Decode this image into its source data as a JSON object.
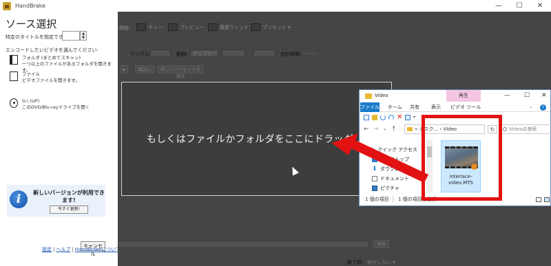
{
  "window": {
    "title": "HandBrake",
    "min_label": "—",
    "max_label": "☐",
    "close_label": "✕"
  },
  "source_panel": {
    "title": "ソース選択",
    "title_spec_label": "特定のタイトルを指定できます:",
    "spinner_up": "▲",
    "spinner_down": "▼",
    "prompt": "エンコードしたいビデオを選んでください:",
    "folder_option": {
      "title": "フォルダ (まとめてスキャン)",
      "desc": "一つ以上のファイルがあるフォルダを開きます。"
    },
    "file_option": {
      "title": "ファイル",
      "desc": "ビデオファイルを開きます。"
    },
    "disc_option": {
      "title": "G:\\ (UP)",
      "desc": "このDVD/Blu-rayドライブを開く"
    },
    "update_notice": "新しいバージョンが利用できます!",
    "update_button": "今すぐ更新!",
    "info_glyph": "i",
    "cancel_button": "キャンセル",
    "links": [
      "設定",
      "ヘルプ",
      "HandBrakeについて"
    ],
    "link_sep": "|"
  },
  "main_dimmed": {
    "toolbar": [
      "開始",
      "キュー",
      "プレビュー",
      "履歴ウィンドウ",
      "プリセット ▾"
    ],
    "angle_label": "アングル:",
    "range_label": "範囲:",
    "range_value": "チャプター",
    "duration_label": "合計時間:",
    "duration_value": "--:--:--",
    "dash": "-",
    "play_glyph": "▶",
    "reload_button": "再読込",
    "save_preset_button": "新しいプリセットを保存",
    "drop_text": "もしくはファイルかフォルダをここにドラッグ ...",
    "browse_button": "参照",
    "when_done_label": "終了時:",
    "when_done_value": "何もしない ▾"
  },
  "explorer": {
    "title": "Video",
    "context_tab": "再生",
    "tabs": [
      "ファイル",
      "ホーム",
      "共有",
      "表示",
      "ビデオ ツール"
    ],
    "min_label": "—",
    "max_label": "☐",
    "close_label": "✕",
    "back_glyph": "←",
    "forward_glyph": "→",
    "down_glyph": "⌄",
    "up_glyph": "↑",
    "address": "« デスク... › Video",
    "address_chevron": "⌄",
    "refresh_glyph": "↻",
    "help_glyph": "?",
    "collapse_glyph": "⌄",
    "search_placeholder": "Videoの検索",
    "nav_items": [
      "クイック アクセス",
      "デスクトップ",
      "ダウンロード",
      "ドキュメント",
      "ピクチャ"
    ],
    "file_name": "interlace-video.MTS",
    "status_count": "1 個の項目",
    "status_selected": "1 個の項目を選択"
  },
  "colors": {
    "highlight": "#e31212",
    "explorer_active_tab": "#1979ca",
    "context_tab": "#f4c6e4",
    "selected_item": "#cce8ff"
  }
}
